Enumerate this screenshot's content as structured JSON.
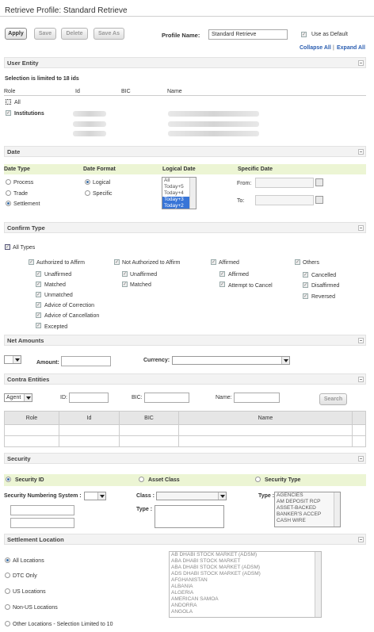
{
  "page": {
    "title": "Retrieve Profile:  Standard Retrieve"
  },
  "toolbar": {
    "apply": "Apply",
    "save": "Save",
    "delete": "Delete",
    "save_as": "Save As",
    "profile_name_label": "Profile Name:",
    "profile_name_value": "Standard Retrieve",
    "use_as_default": "Use as Default",
    "collapse_all": "Collapse All",
    "sep": "|",
    "expand_all": "Expand All"
  },
  "user_entity": {
    "section": "User Entity",
    "note": "Selection is limited to 18 ids",
    "cols": [
      "Role",
      "Id",
      "BIC",
      "Name"
    ],
    "all": "All",
    "institutions": "Institutions"
  },
  "date": {
    "section": "Date",
    "date_type": "Date Type",
    "date_format": "Date Format",
    "logical_date": "Logical Date",
    "specific_date": "Specific Date",
    "types": [
      "Process",
      "Trade",
      "Settlement"
    ],
    "formats": [
      "Logical",
      "Specific"
    ],
    "logical_items": [
      "All",
      "Today+5",
      "Today+4",
      "Today+3",
      "Today+2"
    ],
    "from": "From:",
    "to": "To:"
  },
  "confirm": {
    "section": "Confirm Type",
    "all_types": "All Types",
    "col1": {
      "head": "Authorized to Affirm",
      "items": [
        "Unaffirmed",
        "Matched",
        "Unmatched",
        "Advice of Correction",
        "Advice of Cancellation",
        "Excepted"
      ]
    },
    "col2": {
      "head": "Not Authorized to Affirm",
      "items": [
        "Unaffirmed",
        "Matched"
      ]
    },
    "col3": {
      "head": "Affirmed",
      "items": [
        "Affirmed",
        "Attempt to Cancel"
      ]
    },
    "col4": {
      "head": "Others",
      "items": [
        "Cancelled",
        "Disaffirmed",
        "Reversed"
      ]
    }
  },
  "net": {
    "section": "Net Amounts",
    "amount": "Amount:",
    "currency": "Currency:"
  },
  "contra": {
    "section": "Contra Entities",
    "type_value": "Agent",
    "id": "ID:",
    "bic": "BIC:",
    "name": "Name:",
    "search": "Search",
    "cols": [
      "Role",
      "Id",
      "BIC",
      "Name"
    ]
  },
  "security": {
    "section": "Security",
    "tabs": [
      "Security ID",
      "Asset Class",
      "Security Type"
    ],
    "numbering": "Security Numbering System :",
    "class": "Class :",
    "type": "Type :",
    "type2": "Type :",
    "type_items": [
      "AGENCIES",
      "AM DEPOSIT RCP",
      "ASSET-BACKED",
      "BANKER'S ACCEP",
      "CASH WIRE"
    ]
  },
  "settlement": {
    "section": "Settlement Location",
    "options": [
      "All Locations",
      "DTC Only",
      "US Locations",
      "Non-US Locations",
      "Other Locations - Selection Limited to 10"
    ],
    "locations": [
      "AB DHABI STOCK MARKET (ADSM)",
      "ABA DHABI STOCK MARKET",
      "ABA DHABI STOCK MARKET (ADSM)",
      "ADS DHABI STOCK MARKET (ADSM)",
      "AFGHANISTAN",
      "ALBANIA",
      "ALGERIA",
      "AMERICAN SAMOA",
      "ANDORRA",
      "ANGOLA"
    ]
  }
}
